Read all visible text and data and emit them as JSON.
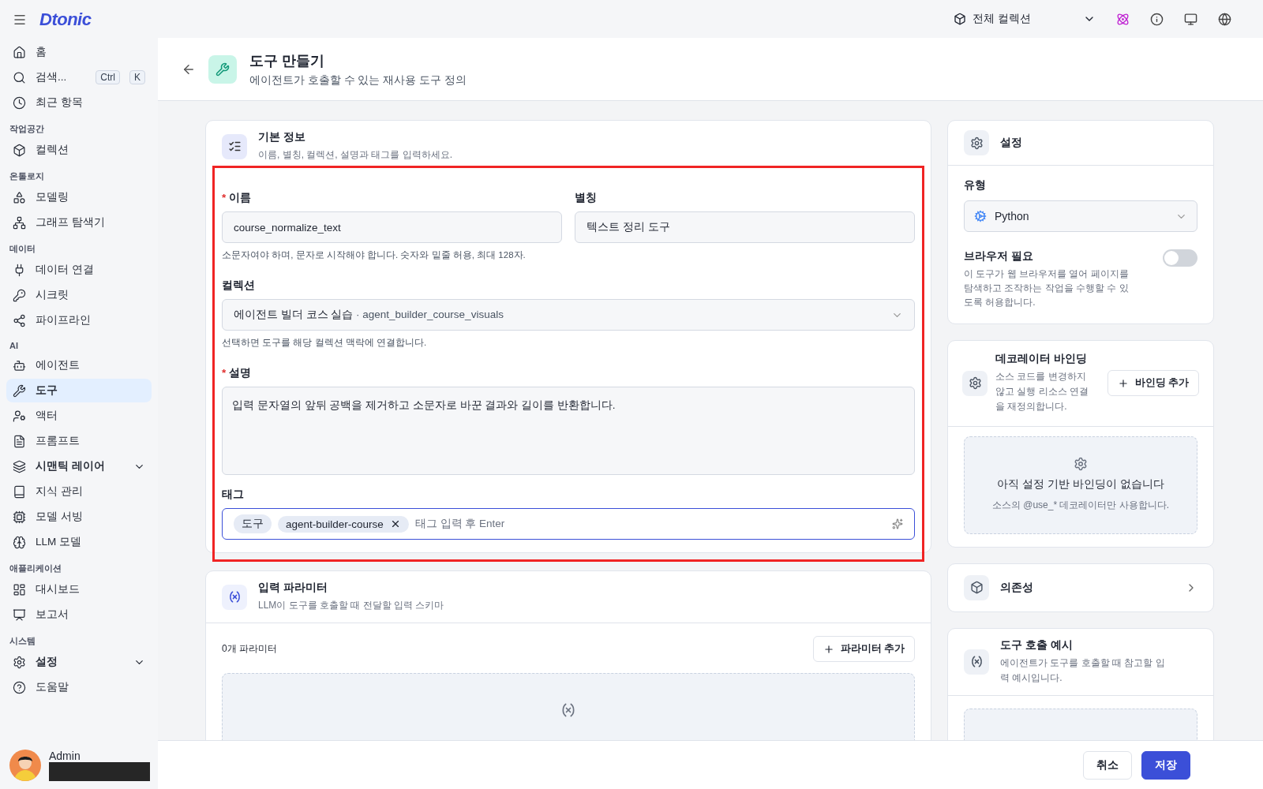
{
  "topbar": {
    "logo": "Dtonic",
    "collection": "전체 컬렉션"
  },
  "sidebar": {
    "items": [
      {
        "kind": "item",
        "label": "홈",
        "selected": false
      },
      {
        "kind": "search",
        "label": "검색...",
        "selected": false,
        "shortcut": [
          "Ctrl",
          "K"
        ]
      },
      {
        "kind": "item",
        "label": "최근 항목",
        "selected": false
      },
      {
        "kind": "section",
        "label": "작업공간"
      },
      {
        "kind": "item",
        "label": "컬렉션",
        "selected": false
      },
      {
        "kind": "section",
        "label": "온톨로지"
      },
      {
        "kind": "item",
        "label": "모델링",
        "selected": false
      },
      {
        "kind": "item",
        "label": "그래프 탐색기",
        "selected": false
      },
      {
        "kind": "section",
        "label": "데이터"
      },
      {
        "kind": "item",
        "label": "데이터 연결",
        "selected": false
      },
      {
        "kind": "item",
        "label": "시크릿",
        "selected": false
      },
      {
        "kind": "item",
        "label": "파이프라인",
        "selected": false
      },
      {
        "kind": "section",
        "label": "AI"
      },
      {
        "kind": "item",
        "label": "에이전트",
        "selected": false
      },
      {
        "kind": "item",
        "label": "도구",
        "selected": true
      },
      {
        "kind": "item",
        "label": "액터",
        "selected": false
      },
      {
        "kind": "item",
        "label": "프롬프트",
        "selected": false
      },
      {
        "kind": "group",
        "label": "시맨틱 레이어",
        "selected": false,
        "expanded": false
      },
      {
        "kind": "item",
        "label": "지식 관리",
        "selected": false
      },
      {
        "kind": "item",
        "label": "모델 서빙",
        "selected": false
      },
      {
        "kind": "item",
        "label": "LLM 모델",
        "selected": false
      },
      {
        "kind": "section",
        "label": "애플리케이션"
      },
      {
        "kind": "item",
        "label": "대시보드",
        "selected": false
      },
      {
        "kind": "item",
        "label": "보고서",
        "selected": false
      },
      {
        "kind": "section",
        "label": "시스템"
      },
      {
        "kind": "group",
        "label": "설정",
        "selected": false,
        "expanded": false
      },
      {
        "kind": "item",
        "label": "도움말",
        "selected": false
      }
    ]
  },
  "user": {
    "name": "Admin",
    "redacted": true
  },
  "page": {
    "title": "도구 만들기",
    "subtitle": "에이전트가 호출할 수 있는 재사용 도구 정의"
  },
  "basic_info": {
    "title": "기본 정보",
    "subtitle": "이름, 별칭, 컬렉션, 설명과 태그를 입력하세요.",
    "annotation": {
      "kind": "outline"
    },
    "required_marker": "*",
    "name": {
      "label": "이름",
      "required": true,
      "value": "course_normalize_text",
      "hint": "소문자여야 하며, 문자로 시작해야 합니다. 숫자와 밑줄 허용, 최대 128자."
    },
    "alias": {
      "label": "별칭",
      "required": false,
      "value": "텍스트 정리 도구"
    },
    "collection": {
      "label": "컬렉션",
      "required": false,
      "value": "에이전트 빌더 코스 실습",
      "detail": "· agent_builder_course_visuals",
      "hint": "선택하면 도구를 해당 컬렉션 맥락에 연결합니다."
    },
    "description": {
      "label": "설명",
      "required": true,
      "value": "입력 문자열의 앞뒤 공백을 제거하고 소문자로 바꾼 결과와 길이를 반환합니다."
    },
    "tags": {
      "label": "태그",
      "required": false,
      "placeholder": "태그 입력 후 Enter",
      "items": [
        {
          "label": "도구",
          "removable": false
        },
        {
          "label": "agent-builder-course",
          "removable": true
        }
      ]
    }
  },
  "params": {
    "title": "입력 파라미터",
    "subtitle": "LLM이 도구를 호출할 때 전달할 입력 스키마",
    "count": "0개 파라미터",
    "add_button": "파라미터 추가"
  },
  "settings": {
    "title": "설정",
    "type_label": "유형",
    "type_value": "Python",
    "browser": {
      "label": "브라우저 필요",
      "description": "이 도구가 웹 브라우저를 열어 페이지를 탐색하고 조작하는 작업을 수행할 수 있도록 허용합니다.",
      "on": false
    }
  },
  "decorator": {
    "title": "데코레이터 바인딩",
    "description": "소스 코드를 변경하지 않고 실행 리소스 연결을 재정의합니다.",
    "button": "바인딩 추가",
    "empty_title": "아직 설정 기반 바인딩이 없습니다",
    "empty_hint": "소스의 @use_* 데코레이터만 사용합니다."
  },
  "dependencies": {
    "title": "의존성"
  },
  "example": {
    "title": "도구 호출 예시",
    "description": "에이전트가 도구를 호출할 때 참고할 입력 예시입니다."
  },
  "footer": {
    "cancel": "취소",
    "save": "저장"
  }
}
